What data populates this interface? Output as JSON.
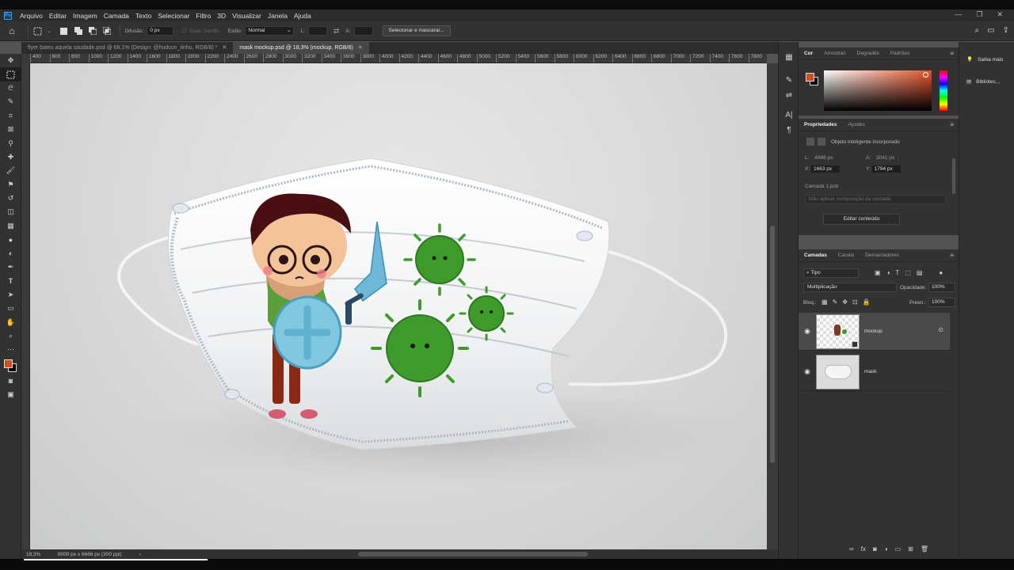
{
  "menu": {
    "app_logo": "Ps",
    "items": [
      "Arquivo",
      "Editar",
      "Imagem",
      "Camada",
      "Texto",
      "Selecionar",
      "Filtro",
      "3D",
      "Visualizar",
      "Janela",
      "Ajuda"
    ]
  },
  "options_bar": {
    "feather_label": "Difusão:",
    "feather_value": "0 px",
    "antialias_label": "Suav. Serrilh.",
    "style_label": "Estilo:",
    "style_value": "Normal",
    "width_label": "L:",
    "height_label": "A:",
    "select_mask_button": "Selecionar e mascarar..."
  },
  "tabs": [
    {
      "label": "flyer bateu aquela saudade.psd @ 68,1% (Design: @hudson_tinho, RGB/8) *",
      "active": false
    },
    {
      "label": "mask mockup.psd @ 18,3% (mockup, RGB/8)",
      "active": true
    }
  ],
  "ruler_ticks": [
    "400",
    "600",
    "800",
    "1000",
    "1200",
    "1400",
    "1600",
    "1800",
    "2000",
    "2200",
    "2400",
    "2600",
    "2800",
    "3000",
    "3200",
    "3400",
    "3600",
    "3800",
    "4000",
    "4200",
    "4400",
    "4600",
    "4800",
    "5000",
    "5200",
    "5400",
    "5600",
    "5800",
    "6000",
    "6200",
    "6400",
    "6600",
    "6800",
    "7000",
    "7200",
    "7400",
    "7600",
    "7800"
  ],
  "status": {
    "zoom": "18,3%",
    "doc_info": "8000 px x 6666 px (300 ppi)"
  },
  "color_panel": {
    "tabs": [
      "Cor",
      "Amostras",
      "Degradês",
      "Padrões"
    ],
    "foreground": "#d14e1e",
    "background": "#000000"
  },
  "properties_panel": {
    "tabs": [
      "Propriedades",
      "Ajustes"
    ],
    "object_type": "Objeto inteligente incorporado",
    "w_label": "L:",
    "w_value": "4688 px",
    "h_label": "A:",
    "h_value": "3041 px",
    "x_label": "X:",
    "x_value": "1663 px",
    "y_label": "Y:",
    "y_value": "1794 px",
    "source": "Camada 1.psb",
    "comp_placeholder": "Não aplicar composição da camada",
    "edit_button": "Editar conteúdo"
  },
  "layers_panel": {
    "tabs": [
      "Camadas",
      "Canais",
      "Demarcadores"
    ],
    "filter": "Tipo",
    "blend_mode": "Multiplicação",
    "opacity_label": "Opacidade:",
    "opacity_value": "100%",
    "lock_label": "Bloq.:",
    "fill_label": "Preen.:",
    "fill_value": "100%",
    "layers": [
      {
        "name": "mockup",
        "selected": true
      },
      {
        "name": "mask",
        "selected": false
      }
    ]
  },
  "far_right": {
    "learn_more": "Saiba mais",
    "libraries": "Bibliotec..."
  }
}
